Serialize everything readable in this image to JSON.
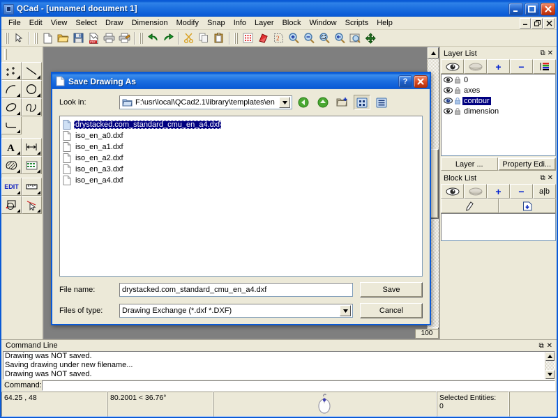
{
  "window": {
    "title": "QCad - [unnamed document 1]",
    "icon": "app-icon",
    "minimize": "_",
    "maximize": "□",
    "close": "✕"
  },
  "menu": {
    "items": [
      {
        "label": "File"
      },
      {
        "label": "Edit"
      },
      {
        "label": "View"
      },
      {
        "label": "Select"
      },
      {
        "label": "Draw"
      },
      {
        "label": "Dimension"
      },
      {
        "label": "Modify"
      },
      {
        "label": "Snap"
      },
      {
        "label": "Info"
      },
      {
        "label": "Layer"
      },
      {
        "label": "Block"
      },
      {
        "label": "Window"
      },
      {
        "label": "Scripts"
      },
      {
        "label": "Help"
      }
    ],
    "mdi_buttons": [
      "_",
      "⧉",
      "✕"
    ]
  },
  "toolbar": {
    "buttons": [
      {
        "name": "select-pointer-icon"
      },
      {
        "name": "new-file-icon"
      },
      {
        "name": "open-folder-icon"
      },
      {
        "name": "save-disk-icon"
      },
      {
        "name": "export-pdf-icon"
      },
      {
        "name": "print-icon"
      },
      {
        "name": "print-preview-icon"
      },
      {
        "name": "undo-icon"
      },
      {
        "name": "redo-icon"
      },
      {
        "name": "cut-scissors-icon"
      },
      {
        "name": "copy-icon"
      },
      {
        "name": "paste-icon"
      },
      {
        "name": "grid-dots-icon"
      },
      {
        "name": "eraser-icon"
      },
      {
        "name": "redraw-icon"
      },
      {
        "name": "zoom-in-icon"
      },
      {
        "name": "zoom-out-icon"
      },
      {
        "name": "zoom-window-icon"
      },
      {
        "name": "zoom-previous-icon"
      },
      {
        "name": "zoom-auto-icon"
      },
      {
        "name": "zoom-pan-icon"
      }
    ]
  },
  "left_dock": {
    "groups": [
      [
        "point-tool",
        "line-tool"
      ],
      [
        "arc-tool",
        "circle-tool"
      ],
      [
        "ellipse-tool",
        "spline-tool"
      ],
      [
        "polyline-tool",
        ""
      ],
      [
        "text-tool",
        "dimension-tool"
      ],
      [
        "hatch-tool",
        "image-tool"
      ],
      [
        "edit-tool",
        "measure-tool"
      ],
      [
        "modify-tool",
        "info-tool"
      ]
    ],
    "edit_label": "EDIT"
  },
  "mdi": {
    "zoom_label": "100"
  },
  "layer_panel": {
    "title": "Layer List",
    "float_glyph": "⧉",
    "close_glyph": "✕",
    "tool_buttons": [
      {
        "name": "show-all-layers-icon",
        "glyph": "eye-open"
      },
      {
        "name": "hide-all-layers-icon",
        "glyph": "eye-closed"
      },
      {
        "name": "add-layer-icon",
        "glyph": "+"
      },
      {
        "name": "remove-layer-icon",
        "glyph": "−"
      },
      {
        "name": "layer-settings-icon",
        "glyph": "list-color"
      }
    ],
    "layers": [
      {
        "name": "0",
        "selected": false
      },
      {
        "name": "axes",
        "selected": false
      },
      {
        "name": "contour",
        "selected": true
      },
      {
        "name": "dimension",
        "selected": false
      }
    ],
    "tabs": [
      {
        "label": "Layer ...",
        "active": false
      },
      {
        "label": "Property Edi...",
        "active": true
      }
    ]
  },
  "block_panel": {
    "title": "Block List",
    "float_glyph": "⧉",
    "close_glyph": "✕",
    "tool_buttons": [
      {
        "name": "show-all-blocks-icon",
        "glyph": "eye-open"
      },
      {
        "name": "hide-all-blocks-icon",
        "glyph": "eye-closed"
      },
      {
        "name": "add-block-icon",
        "glyph": "+"
      },
      {
        "name": "remove-block-icon",
        "glyph": "−"
      },
      {
        "name": "rename-block-icon",
        "glyph": "a|b"
      }
    ],
    "tool_buttons_row2": [
      {
        "name": "edit-block-icon",
        "glyph": "pencil"
      },
      {
        "name": "insert-block-icon",
        "glyph": "insert"
      }
    ]
  },
  "command_panel": {
    "title": "Command Line",
    "float_glyph": "⧉",
    "close_glyph": "✕",
    "lines": [
      "Drawing  was NOT saved.",
      "Saving drawing under new filename...",
      "Drawing  was NOT saved."
    ],
    "prompt": "Command:",
    "input_value": ""
  },
  "status_bar": {
    "coordinates": "64.25 , 48",
    "relative": "80.2001 < 36.76°",
    "mouse_icon": "mouse-icon",
    "selected_label": "Selected Entities:",
    "selected_count": "0"
  },
  "dialog": {
    "title": "Save Drawing As",
    "icon": "document-icon",
    "help_glyph": "?",
    "close_glyph": "✕",
    "lookin_label": "Look in:",
    "lookin_path": "F:\\usr\\local\\QCad2.1\\library\\templates\\en",
    "nav_buttons": [
      {
        "name": "back-button",
        "glyph": "back"
      },
      {
        "name": "parent-folder-button",
        "glyph": "up"
      },
      {
        "name": "new-folder-button",
        "glyph": "newfolder"
      },
      {
        "name": "list-view-button",
        "glyph": "listview",
        "pressed": true
      },
      {
        "name": "detail-view-button",
        "glyph": "detailview",
        "pressed": false
      }
    ],
    "files": [
      {
        "name": "drystacked.com_standard_cmu_en_a4.dxf",
        "selected": true
      },
      {
        "name": "iso_en_a0.dxf",
        "selected": false
      },
      {
        "name": "iso_en_a1.dxf",
        "selected": false
      },
      {
        "name": "iso_en_a2.dxf",
        "selected": false
      },
      {
        "name": "iso_en_a3.dxf",
        "selected": false
      },
      {
        "name": "iso_en_a4.dxf",
        "selected": false
      }
    ],
    "filename_label": "File name:",
    "filename_value": "drystacked.com_standard_cmu_en_a4.dxf",
    "filetype_label": "Files of type:",
    "filetype_value": "Drawing Exchange (*.dxf *.DXF)",
    "save_button": "Save",
    "cancel_button": "Cancel"
  },
  "colors": {
    "title_blue": "#0a5ad6",
    "face": "#ece9d8",
    "selection_navy": "#000080",
    "close_red": "#d8481e"
  }
}
